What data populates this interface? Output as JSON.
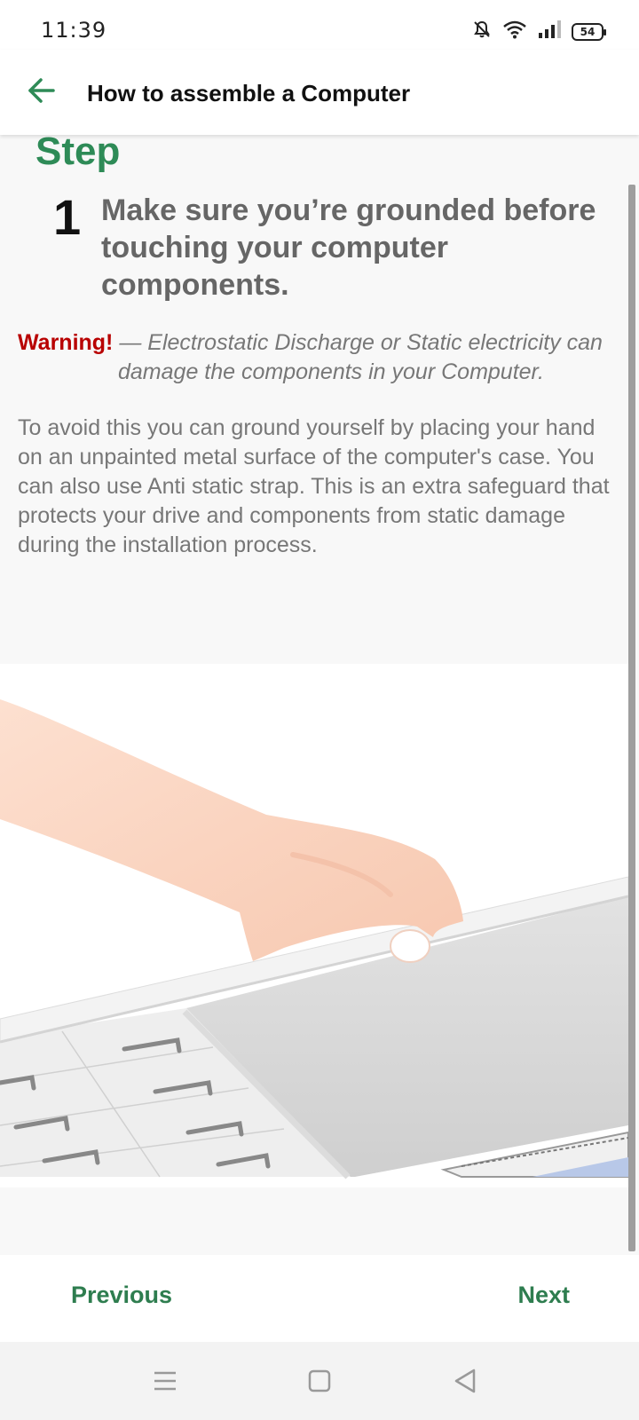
{
  "status_bar": {
    "time": "11:39",
    "battery": "54",
    "icons": [
      "bell-off-icon",
      "wifi-icon",
      "signal-icon",
      "battery-icon"
    ]
  },
  "app_bar": {
    "title": "How to assemble a Computer",
    "back_icon": "arrow-left-icon"
  },
  "step": {
    "label": "Step",
    "number": "1",
    "heading": "Make sure you’re grounded before touching your computer components.",
    "warning_label": "Warning!",
    "warning_text": " — Electrostatic Discharge or Static electricity can damage the components in your Computer.",
    "body": "To avoid this you can ground yourself by placing your hand on an unpainted metal surface of the computer's case. You can also use Anti static strap. This is an extra safeguard that protects your drive and components from static damage during the installation process."
  },
  "navigation": {
    "previous_label": "Previous",
    "next_label": "Next"
  },
  "system_nav": {
    "icons": [
      "menu-icon",
      "home-square-icon",
      "back-triangle-icon"
    ]
  },
  "colors": {
    "accent": "#2e8b57",
    "warning": "#b80000",
    "body_text": "#777777"
  }
}
